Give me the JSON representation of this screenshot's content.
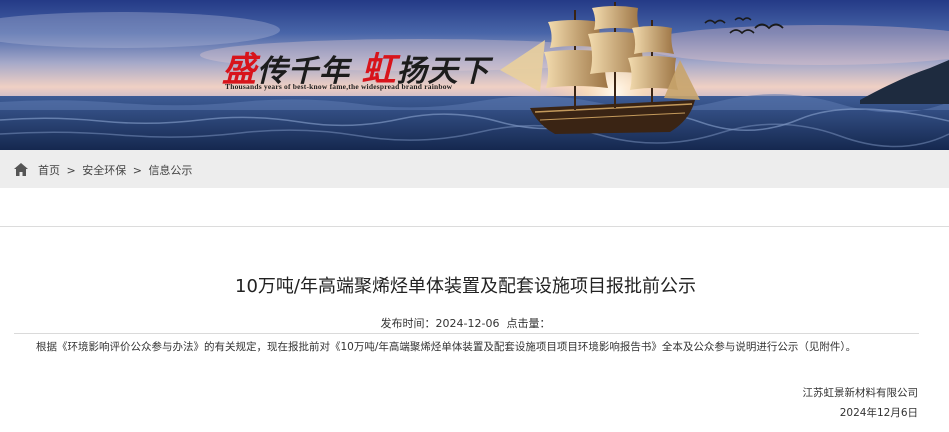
{
  "banner": {
    "slogan_part1": "盛",
    "slogan_part2": "传千年",
    "slogan_part3": "虹",
    "slogan_part4": "扬天下",
    "slogan_en": "Thousands years of best-know fame,the widespread brand rainbow"
  },
  "breadcrumb": {
    "home_icon": "home-icon",
    "items": [
      "首页",
      ">",
      "安全环保",
      ">",
      "信息公示"
    ]
  },
  "article": {
    "title": "10万吨/年高端聚烯烃单体装置及配套设施项目报批前公示",
    "meta": {
      "publish_label": "发布时间：",
      "publish_date": "2024-12-06",
      "clicks_label": "点击量："
    },
    "body": "根据《环境影响评价公众参与办法》的有关规定，现在报批前对《10万吨/年高端聚烯烃单体装置及配套设施项目项目环境影响报告书》全本及公众参与说明进行公示（见附件）。",
    "company": "江苏虹景新材料有限公司",
    "date": "2024年12月6日"
  },
  "colors": {
    "slogan_red": "#d8141b",
    "crumb_bg": "#ededed"
  }
}
